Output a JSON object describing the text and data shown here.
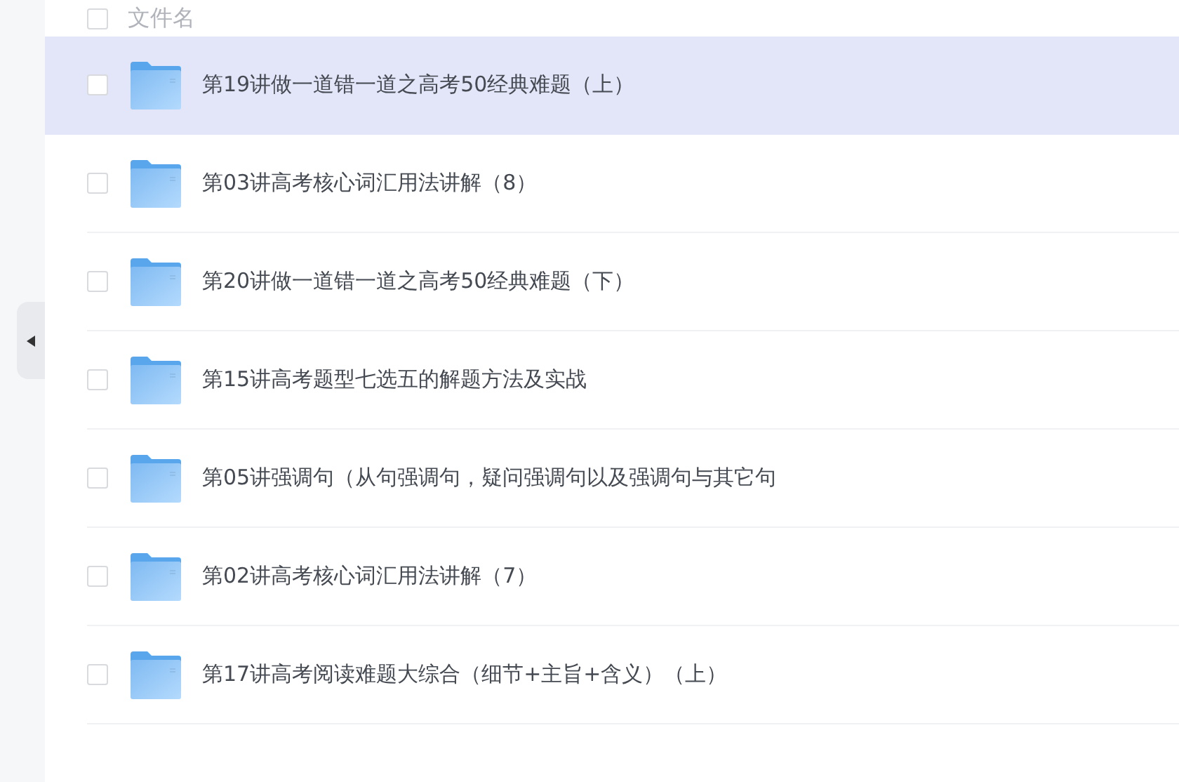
{
  "header": {
    "label": "文件名",
    "checked": false
  },
  "rows": [
    {
      "name": "第19讲做一道错一道之高考50经典难题（上）",
      "selected": true,
      "checked": false
    },
    {
      "name": "第03讲高考核心词汇用法讲解（8）",
      "selected": false,
      "checked": false
    },
    {
      "name": "第20讲做一道错一道之高考50经典难题（下）",
      "selected": false,
      "checked": false
    },
    {
      "name": "第15讲高考题型七选五的解题方法及实战",
      "selected": false,
      "checked": false
    },
    {
      "name": "第05讲强调句（从句强调句，疑问强调句以及强调句与其它句",
      "selected": false,
      "checked": false
    },
    {
      "name": "第02讲高考核心词汇用法讲解（7）",
      "selected": false,
      "checked": false
    },
    {
      "name": "第17讲高考阅读难题大综合（细节+主旨+含义）（上）",
      "selected": false,
      "checked": false
    }
  ]
}
